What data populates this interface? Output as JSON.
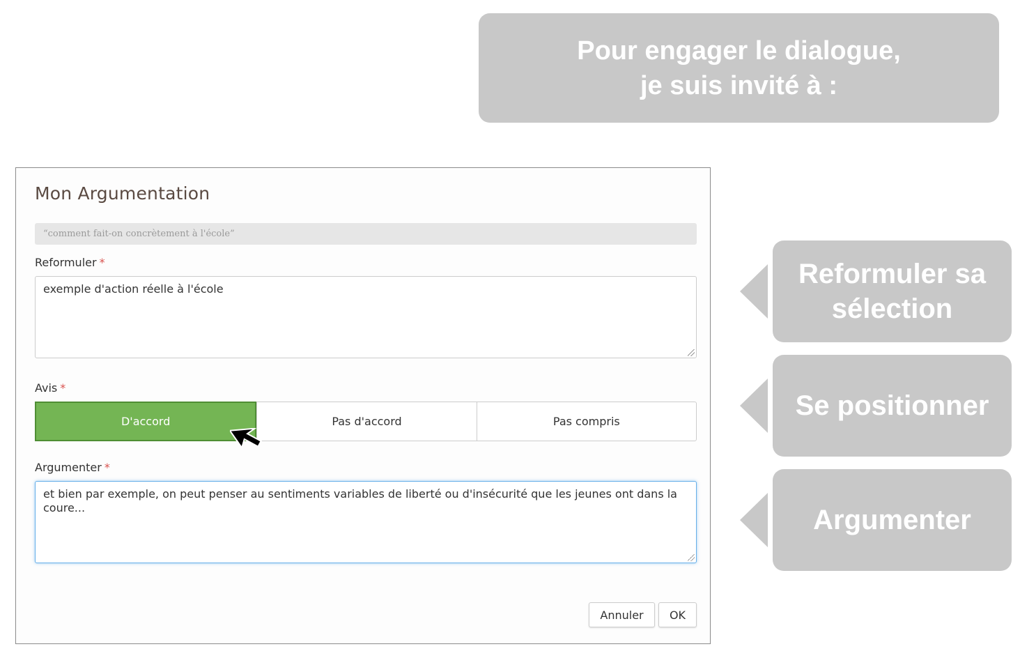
{
  "callouts": {
    "top_line1": "Pour engager le dialogue,",
    "top_line2": "je suis invité à :",
    "side1": "Reformuler sa sélection",
    "side2": "Se positionner",
    "side3": "Argumenter",
    "color": "#c8c8c8"
  },
  "dialog": {
    "title": "Mon Argumentation",
    "quote": "“comment fait-on concrètement à l'école”",
    "reformuler": {
      "label": "Reformuler",
      "required_mark": "*",
      "value": "exemple d'action réelle à l'école"
    },
    "avis": {
      "label": "Avis",
      "required_mark": "*",
      "options": [
        "D'accord",
        "Pas d'accord",
        "Pas compris"
      ],
      "selected": "D'accord",
      "active_color": "#74b554"
    },
    "argumenter": {
      "label": "Argumenter",
      "required_mark": "*",
      "value": "et bien par exemple, on peut penser au sentiments variables de liberté ou d'insécurité que les jeunes ont dans la coure..."
    },
    "buttons": {
      "cancel": "Annuler",
      "ok": "OK"
    }
  },
  "icons": {
    "pointer": "mouse-pointer-icon"
  }
}
